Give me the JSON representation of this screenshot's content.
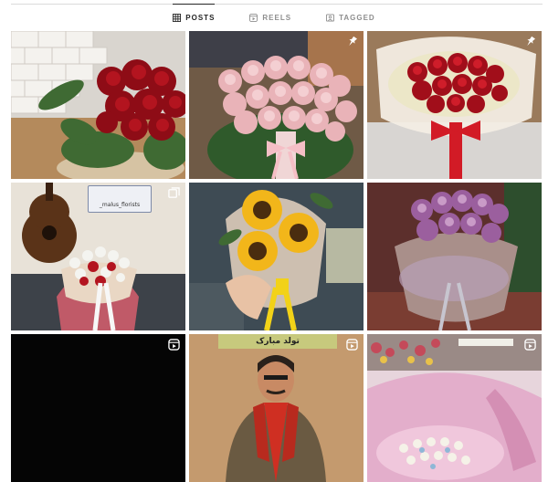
{
  "tabs": [
    {
      "label": "POSTS",
      "icon": "grid-icon",
      "active": true
    },
    {
      "label": "REELS",
      "icon": "reels-icon",
      "active": false
    },
    {
      "label": "TAGGED",
      "icon": "tagged-icon",
      "active": false
    }
  ],
  "posts": [
    {
      "subject": "red roses bouquet with greenery",
      "badge": null
    },
    {
      "subject": "pink roses bouquet",
      "badge": "pin-icon"
    },
    {
      "subject": "red roses bouquet in white wrap",
      "badge": "pin-icon"
    },
    {
      "subject": "guitar and white-red flower box",
      "badge": "carousel-icon",
      "tag_text": "_malus_florists"
    },
    {
      "subject": "sunflower bouquet",
      "badge": null
    },
    {
      "subject": "purple chrysanthemum bouquet",
      "badge": null
    },
    {
      "subject": "black video frame",
      "badge": "reel-icon"
    },
    {
      "subject": "man in red scarf",
      "badge": "reel-icon",
      "caption": "تولد مبارک"
    },
    {
      "subject": "pink bouquet with candies",
      "badge": "reel-icon"
    }
  ],
  "colors": {
    "active_tab": "#262626",
    "inactive_tab": "#8e8e8e",
    "divider": "#dbdbdb"
  }
}
